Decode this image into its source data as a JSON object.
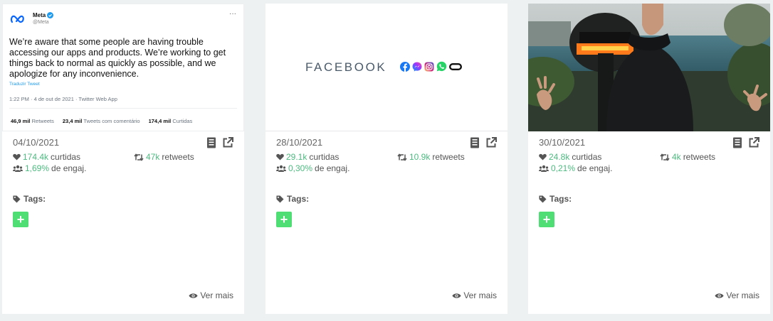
{
  "cards": [
    {
      "date": "04/10/2021",
      "likes_value": "174.4k",
      "likes_label": "curtidas",
      "retweets_value": "47k",
      "retweets_label": "retweets",
      "engagement_value": "1,69%",
      "engagement_label": "de engaj.",
      "tags_label": "Tags:",
      "add_label": "+",
      "ver_mais": "Ver mais",
      "tweet": {
        "name": "Meta",
        "handle": "@Meta",
        "more": "···",
        "text": "We’re aware that some people are having trouble accessing our apps and products. We’re working to get things back to normal as quickly as possible, and we apologize for any inconvenience.",
        "translate": "Traduzir Tweet",
        "meta": "1:22 PM · 4 de out de 2021 · Twitter Web App",
        "stats": [
          {
            "value": "46,9 mil",
            "label": "Retweets"
          },
          {
            "value": "23,4 mil",
            "label": "Tweets com comentário"
          },
          {
            "value": "174,4 mil",
            "label": "Curtidas"
          }
        ]
      }
    },
    {
      "date": "28/10/2021",
      "likes_value": "29.1k",
      "likes_label": "curtidas",
      "retweets_value": "10.9k",
      "retweets_label": "retweets",
      "engagement_value": "0,30%",
      "engagement_label": "de engaj.",
      "tags_label": "Tags:",
      "add_label": "+",
      "ver_mais": "Ver mais",
      "brand_word": "FACEBOOK",
      "brand_icons": [
        "facebook-icon",
        "messenger-icon",
        "instagram-icon",
        "whatsapp-icon",
        "oculus-icon"
      ]
    },
    {
      "date": "30/10/2021",
      "likes_value": "24.8k",
      "likes_label": "curtidas",
      "retweets_value": "4k",
      "retweets_label": "retweets",
      "engagement_value": "0,21%",
      "engagement_label": "de engaj.",
      "tags_label": "Tags:",
      "add_label": "+",
      "ver_mais": "Ver mais"
    }
  ],
  "colors": {
    "accent_green": "#4cbb7f",
    "add_button": "#4ede74",
    "background": "#eef1f2",
    "twitter_blue": "#1d9bf0"
  }
}
